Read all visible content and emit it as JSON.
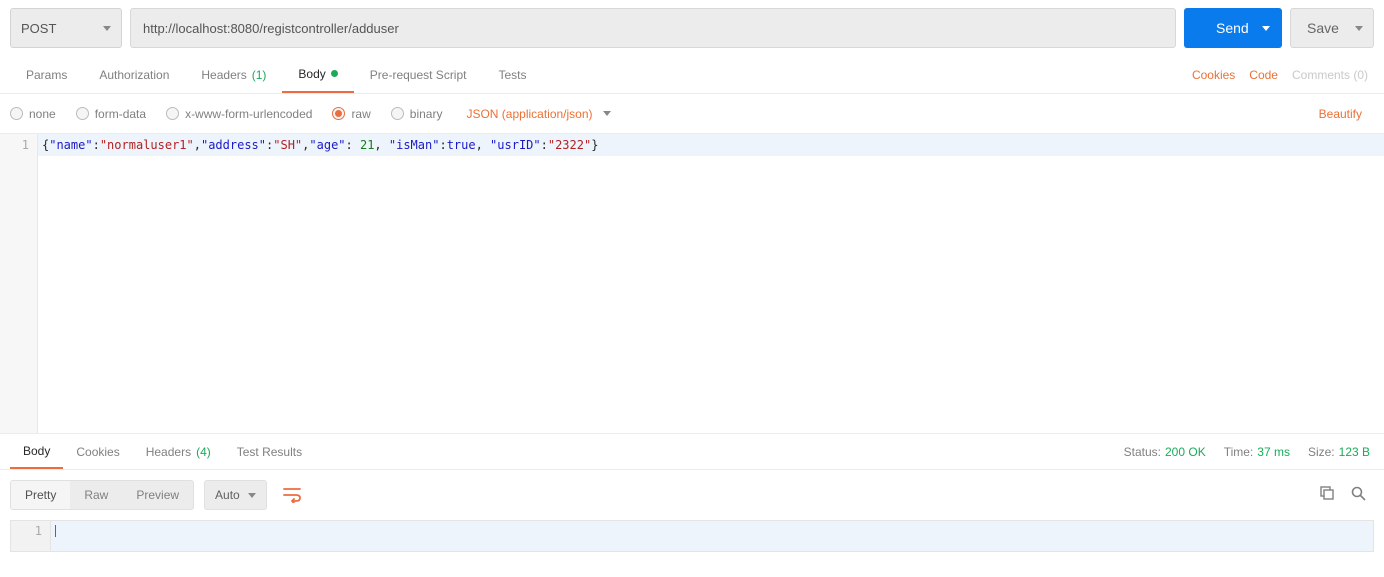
{
  "request": {
    "method": "POST",
    "url": "http://localhost:8080/registcontroller/adduser",
    "send_label": "Send",
    "save_label": "Save"
  },
  "tabs": {
    "params": "Params",
    "authorization": "Authorization",
    "headers": "Headers",
    "headers_count": "(1)",
    "body": "Body",
    "prerequest": "Pre-request Script",
    "tests": "Tests"
  },
  "right_links": {
    "cookies": "Cookies",
    "code": "Code",
    "comments": "Comments (0)"
  },
  "body_types": {
    "none": "none",
    "formdata": "form-data",
    "urlencoded": "x-www-form-urlencoded",
    "raw": "raw",
    "binary": "binary",
    "content_type": "JSON (application/json)",
    "beautify": "Beautify"
  },
  "editor": {
    "gutter_1": "1",
    "tokens": [
      {
        "t": "brace",
        "v": "{"
      },
      {
        "t": "key",
        "v": "\"name\""
      },
      {
        "t": "punc",
        "v": ":"
      },
      {
        "t": "val",
        "v": "\"normaluser1\""
      },
      {
        "t": "punc",
        "v": ","
      },
      {
        "t": "key",
        "v": "\"address\""
      },
      {
        "t": "punc",
        "v": ":"
      },
      {
        "t": "val",
        "v": "\"SH\""
      },
      {
        "t": "punc",
        "v": ","
      },
      {
        "t": "key",
        "v": "\"age\""
      },
      {
        "t": "punc",
        "v": ": "
      },
      {
        "t": "num",
        "v": "21"
      },
      {
        "t": "punc",
        "v": ", "
      },
      {
        "t": "key",
        "v": "\"isMan\""
      },
      {
        "t": "punc",
        "v": ":"
      },
      {
        "t": "bool",
        "v": "true"
      },
      {
        "t": "punc",
        "v": ", "
      },
      {
        "t": "key",
        "v": "\"usrID\""
      },
      {
        "t": "punc",
        "v": ":"
      },
      {
        "t": "val",
        "v": "\"2322\""
      },
      {
        "t": "brace",
        "v": "}"
      }
    ]
  },
  "response": {
    "tabs": {
      "body": "Body",
      "cookies": "Cookies",
      "headers": "Headers",
      "headers_count": "(4)",
      "test_results": "Test Results"
    },
    "status_label": "Status:",
    "status_value": "200 OK",
    "time_label": "Time:",
    "time_value": "37 ms",
    "size_label": "Size:",
    "size_value": "123 B",
    "view": {
      "pretty": "Pretty",
      "raw": "Raw",
      "preview": "Preview",
      "auto": "Auto"
    },
    "gutter_1": "1"
  }
}
